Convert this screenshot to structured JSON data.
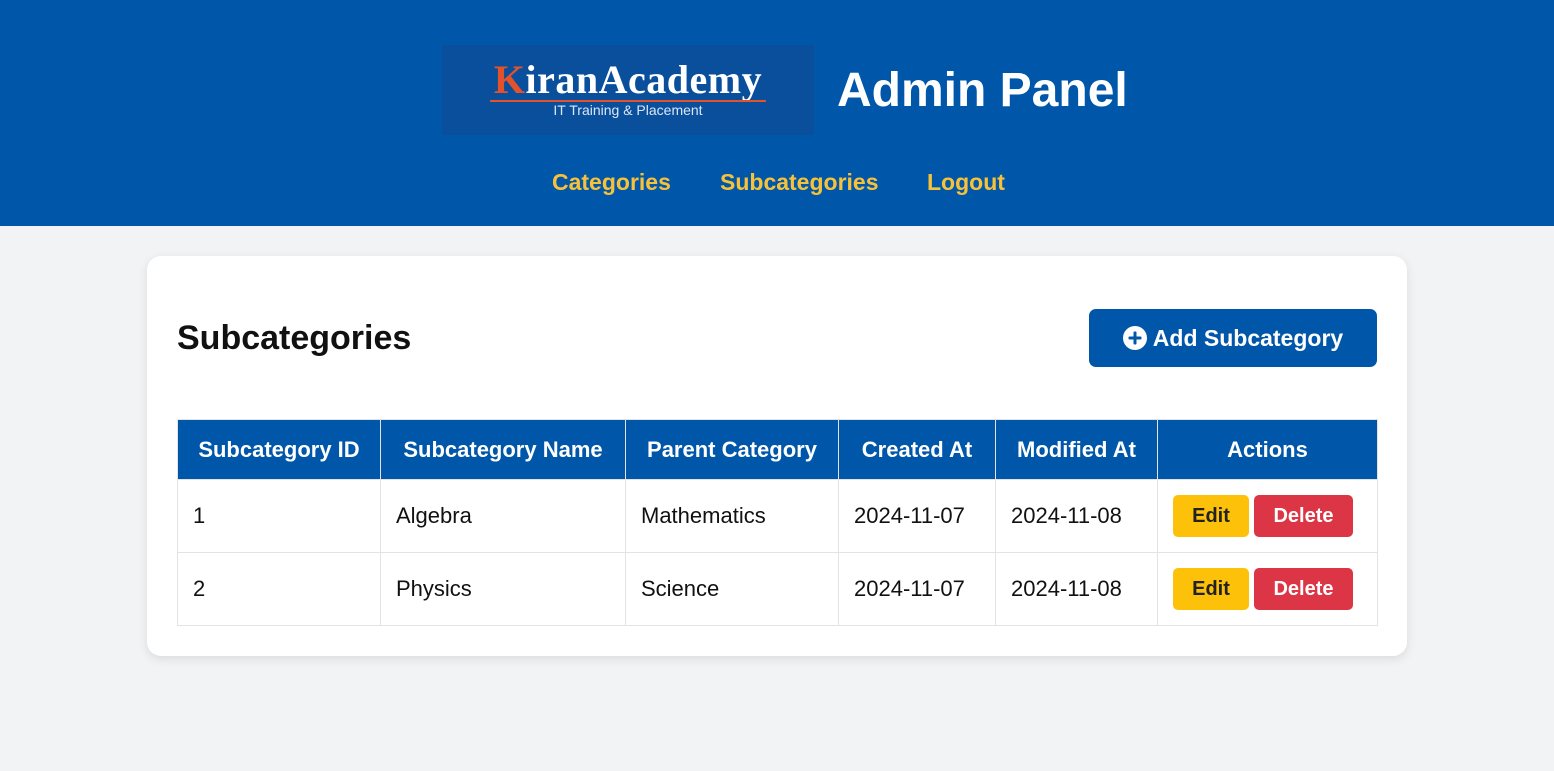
{
  "header": {
    "logo": {
      "brand_first": "K",
      "brand_rest": "iranAcademy",
      "tagline": "IT Training & Placement"
    },
    "title": "Admin Panel",
    "nav": [
      {
        "label": "Categories"
      },
      {
        "label": "Subcategories"
      },
      {
        "label": "Logout"
      }
    ]
  },
  "main": {
    "title": "Subcategories",
    "add_button_label": "Add Subcategory",
    "table": {
      "columns": [
        "Subcategory ID",
        "Subcategory Name",
        "Parent Category",
        "Created At",
        "Modified At",
        "Actions"
      ],
      "rows": [
        {
          "id": "1",
          "name": "Algebra",
          "parent": "Mathematics",
          "created": "2024-11-07",
          "modified": "2024-11-08"
        },
        {
          "id": "2",
          "name": "Physics",
          "parent": "Science",
          "created": "2024-11-07",
          "modified": "2024-11-08"
        }
      ],
      "edit_label": "Edit",
      "delete_label": "Delete"
    }
  },
  "colors": {
    "header_bg": "#0056a8",
    "nav_link": "#f7c23a",
    "edit_button": "#fdc10a",
    "delete_button": "#dc3546",
    "page_bg": "#f2f3f5"
  },
  "icons": {
    "add_button_icon": "plus-circle-icon"
  }
}
